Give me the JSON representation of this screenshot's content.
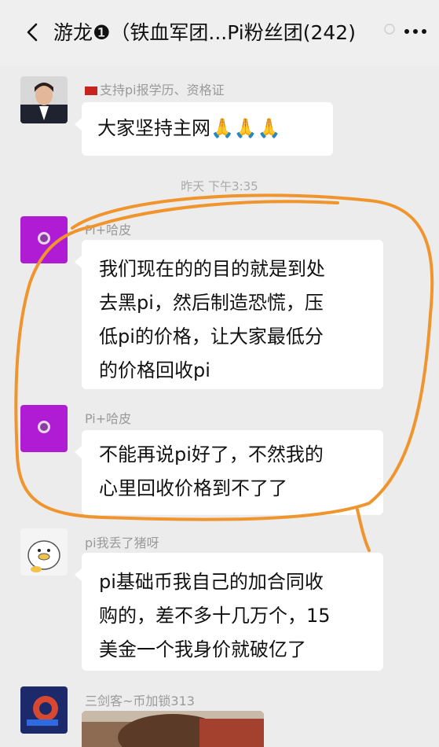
{
  "header": {
    "title": "游龙❶（铁血军团...Pi粉丝团(242)",
    "back_icon": "back-chevron-icon",
    "more_icon": "more-icon",
    "more_text": "…"
  },
  "timestamp": "昨天 下午3:35",
  "messages": [
    {
      "sender": "支持pi报学历、资格证",
      "text": "大家坚持主网🙏🙏🙏"
    },
    {
      "sender": "Pi+哈皮",
      "lines": [
        "我们现在的的目的就是到处",
        "去黑pi，然后制造恐慌，压",
        "低pi的价格，让大家最低分",
        "的价格回收pi"
      ]
    },
    {
      "sender": "Pi+哈皮",
      "lines": [
        "不能再说pi好了，不然我的",
        "心里回收价格到不了了"
      ]
    },
    {
      "sender": "pi我丢了猪呀",
      "lines": [
        "pi基础币我自己的加合同收",
        "购的，差不多十几万个，15",
        "美金一个我身价就破亿了"
      ]
    },
    {
      "sender": "三剑客~币加锁313"
    }
  ],
  "colors": {
    "annotation_circle": "#f0952e",
    "avatar_purple": "#b01bd4",
    "bubble_bg": "#ffffff",
    "background": "#ececec"
  }
}
